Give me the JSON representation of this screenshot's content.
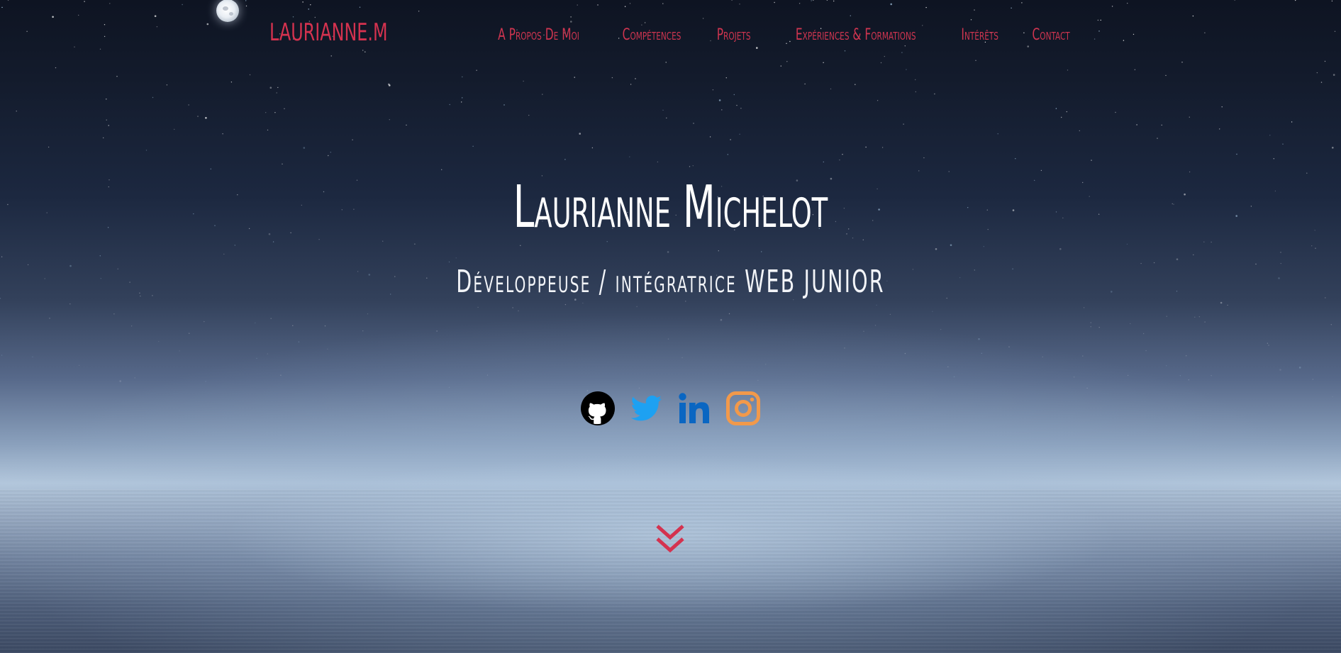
{
  "brand": {
    "logo_text": "LAURIANNE.M",
    "accent_color": "#d4324f"
  },
  "nav": {
    "items": [
      {
        "label": "A Propos De Moi"
      },
      {
        "label": "Compétences"
      },
      {
        "label": "Projets"
      },
      {
        "label": "Expériences & Formations"
      },
      {
        "label": "Intérêts"
      },
      {
        "label": "Contact"
      }
    ]
  },
  "hero": {
    "title": "Laurianne Michelot",
    "subtitle": "Développeuse / intégratrice WEB JUNIOR",
    "background": "starry-night-over-sea"
  },
  "socials": [
    {
      "icon": "github-icon",
      "color": "#000000"
    },
    {
      "icon": "twitter-icon",
      "color": "#1da1f2"
    },
    {
      "icon": "linkedin-icon",
      "color": "#0a66c2"
    },
    {
      "icon": "instagram-icon",
      "color": "#f2994a"
    }
  ],
  "scroll_indicator": {
    "icon": "double-chevron-down-icon",
    "color": "#d4324f"
  }
}
